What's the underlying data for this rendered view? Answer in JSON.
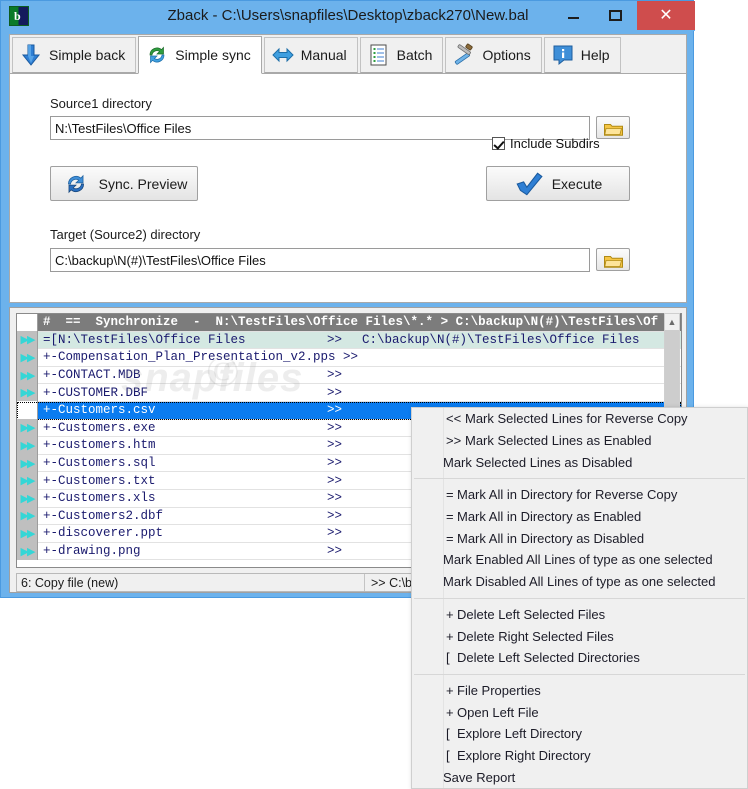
{
  "window": {
    "title": "Zback - C:\\Users\\snapfiles\\Desktop\\zback270\\New.bal",
    "app_icon": "zback-logo-icon",
    "minimize_label": "–",
    "maximize_label": "□",
    "close_label": "✕",
    "accent_titlebar": "#6cb2ec",
    "accent_close": "#cf4d4d"
  },
  "tabs": [
    {
      "label": "Simple back",
      "icon": "down-arrow-icon",
      "active": false
    },
    {
      "label": "Simple sync",
      "icon": "sync-refresh-icon",
      "active": true
    },
    {
      "label": "Manual",
      "icon": "left-right-arrow-icon",
      "active": false
    },
    {
      "label": "Batch",
      "icon": "document-list-icon",
      "active": false
    },
    {
      "label": "Options",
      "icon": "tools-hammer-wrench-icon",
      "active": false
    },
    {
      "label": "Help",
      "icon": "info-bubble-icon",
      "active": false
    }
  ],
  "form": {
    "source1_label": "Source1 directory",
    "source1_value": "N:\\TestFiles\\Office Files",
    "source1_browse_icon": "folder-icon",
    "include_subdirs_label": "Include Subdirs",
    "include_subdirs_checked": true,
    "sync_preview_label": "Sync. Preview",
    "sync_preview_icon": "sync-refresh-icon",
    "execute_label": "Execute",
    "execute_icon": "blue-checkmark-icon",
    "target_label": "Target (Source2) directory",
    "target_value": "C:\\backup\\N(#)\\TestFiles\\Office Files",
    "target_browse_icon": "folder-icon"
  },
  "filelist": {
    "scroll_up_icon": "chevron-up-icon",
    "rows": [
      {
        "kind": "header",
        "gutter": "",
        "name": "#  ==  Synchronize  -  N:\\TestFiles\\Office Files\\*.* > C:\\backup\\N(#)\\TestFiles\\Of",
        "arrow": "",
        "target": ""
      },
      {
        "kind": "dir",
        "gutter": "fast-forward-icon",
        "name": "=[N:\\TestFiles\\Office Files",
        "arrow": ">>",
        "target": "C:\\backup\\N(#)\\TestFiles\\Office Files"
      },
      {
        "kind": "file",
        "gutter": "fast-forward-icon",
        "name": "+-Compensation_Plan_Presentation_v2.pps >>",
        "arrow": "",
        "target": ""
      },
      {
        "kind": "file",
        "gutter": "fast-forward-icon",
        "name": "+-CONTACT.MDB",
        "arrow": ">>",
        "target": ""
      },
      {
        "kind": "file",
        "gutter": "fast-forward-icon",
        "name": "+-CUSTOMER.DBF",
        "arrow": ">>",
        "target": ""
      },
      {
        "kind": "selected",
        "gutter": "",
        "name": "+-Customers.csv",
        "arrow": ">>",
        "target": ""
      },
      {
        "kind": "file",
        "gutter": "fast-forward-icon",
        "name": "+-Customers.exe",
        "arrow": ">>",
        "target": ""
      },
      {
        "kind": "file",
        "gutter": "fast-forward-icon",
        "name": "+-customers.htm",
        "arrow": ">>",
        "target": ""
      },
      {
        "kind": "file",
        "gutter": "fast-forward-icon",
        "name": "+-Customers.sql",
        "arrow": ">>",
        "target": ""
      },
      {
        "kind": "file",
        "gutter": "fast-forward-icon",
        "name": "+-Customers.txt",
        "arrow": ">>",
        "target": ""
      },
      {
        "kind": "file",
        "gutter": "fast-forward-icon",
        "name": "+-Customers.xls",
        "arrow": ">>",
        "target": ""
      },
      {
        "kind": "file",
        "gutter": "fast-forward-icon",
        "name": "+-Customers2.dbf",
        "arrow": ">>",
        "target": ""
      },
      {
        "kind": "file",
        "gutter": "fast-forward-icon",
        "name": "+-discoverer.ppt",
        "arrow": ">>",
        "target": ""
      },
      {
        "kind": "file",
        "gutter": "fast-forward-icon",
        "name": "+-drawing.png",
        "arrow": ">>",
        "target": ""
      }
    ],
    "status_left": "6: Copy file (new)",
    "status_right": ">> C:\\ba"
  },
  "context_menu": [
    {
      "prefix": "<<",
      "label": "Mark Selected Lines for Reverse Copy"
    },
    {
      "prefix": ">>",
      "label": "Mark Selected Lines as Enabled"
    },
    {
      "prefix": "",
      "label": "Mark Selected Lines as Disabled"
    },
    {
      "separator": true
    },
    {
      "prefix": "=",
      "label": "Mark All in Directory for Reverse Copy"
    },
    {
      "prefix": "=",
      "label": "Mark All in Directory as Enabled"
    },
    {
      "prefix": "=",
      "label": "Mark All in Directory as Disabled"
    },
    {
      "prefix": "",
      "label": "Mark Enabled All Lines of type as one selected"
    },
    {
      "prefix": "",
      "label": "Mark Disabled All Lines of type as one selected"
    },
    {
      "separator": true
    },
    {
      "prefix": "+",
      "label": "Delete Left Selected Files"
    },
    {
      "prefix": "+",
      "label": "Delete Right Selected Files"
    },
    {
      "prefix": "[",
      "label": "Delete Left Selected Directories"
    },
    {
      "separator": true
    },
    {
      "prefix": "+",
      "label": "File Properties"
    },
    {
      "prefix": "+",
      "label": "Open Left File"
    },
    {
      "prefix": "[",
      "label": "Explore Left  Directory"
    },
    {
      "prefix": "[",
      "label": "Explore Right Directory"
    },
    {
      "prefix": "",
      "label": "Save Report"
    }
  ],
  "watermark": {
    "text": "snapfiles",
    "symbol": "©"
  }
}
